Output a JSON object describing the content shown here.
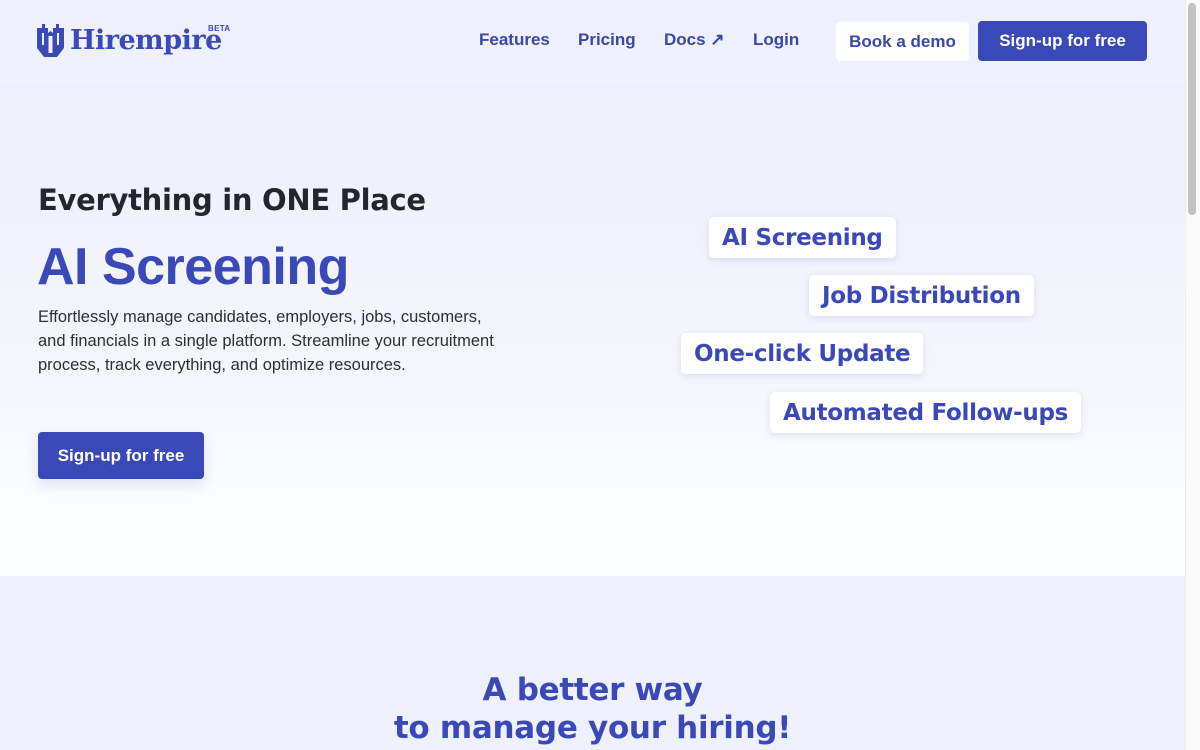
{
  "brand": {
    "name": "Hirempire",
    "badge": "BETA",
    "logo_icon": "castle-shield-icon",
    "primary_color": "#3a48b8"
  },
  "nav": {
    "items": [
      {
        "label": "Features"
      },
      {
        "label": "Pricing"
      },
      {
        "label": "Docs ↗",
        "icon": "external-link-arrow-icon"
      },
      {
        "label": "Login"
      }
    ],
    "book_demo_label": "Book a demo",
    "signup_label": "Sign-up for free"
  },
  "hero": {
    "eyebrow": "Everything in ONE Place",
    "headline": "AI Screening",
    "description": "Effortlessly manage candidates, employers, jobs, customers, and financials in a single platform. Streamline your recruitment process, track everything, and optimize resources.",
    "cta_label": "Sign-up for free",
    "feature_pills": [
      {
        "label": "AI Screening"
      },
      {
        "label": "Job Distribution"
      },
      {
        "label": "One-click Update"
      },
      {
        "label": "Automated Follow-ups"
      }
    ]
  },
  "section2": {
    "title_line1": "A better way",
    "title_line2": "to manage your hiring!"
  }
}
